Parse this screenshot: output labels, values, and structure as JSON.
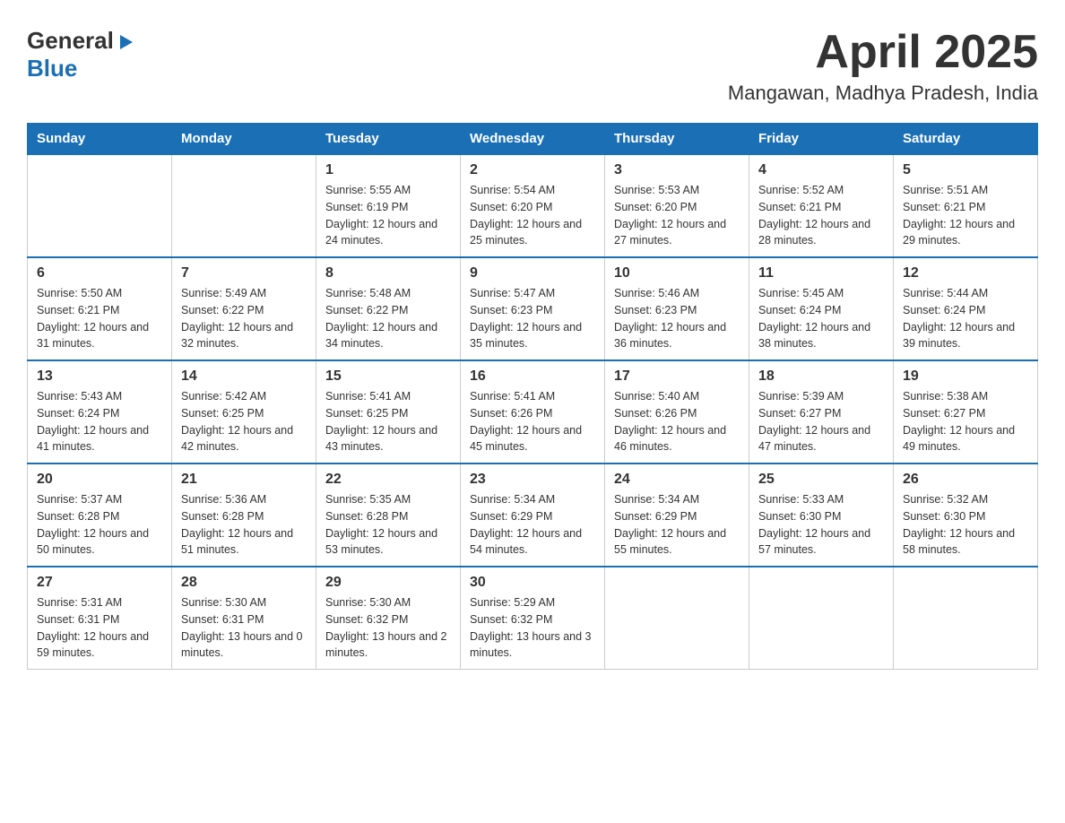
{
  "header": {
    "logo": {
      "general": "General",
      "blue": "Blue",
      "triangle": "▶"
    },
    "title": "April 2025",
    "subtitle": "Mangawan, Madhya Pradesh, India"
  },
  "calendar": {
    "headers": [
      "Sunday",
      "Monday",
      "Tuesday",
      "Wednesday",
      "Thursday",
      "Friday",
      "Saturday"
    ],
    "weeks": [
      [
        {
          "day": "",
          "sunrise": "",
          "sunset": "",
          "daylight": ""
        },
        {
          "day": "",
          "sunrise": "",
          "sunset": "",
          "daylight": ""
        },
        {
          "day": "1",
          "sunrise": "Sunrise: 5:55 AM",
          "sunset": "Sunset: 6:19 PM",
          "daylight": "Daylight: 12 hours and 24 minutes."
        },
        {
          "day": "2",
          "sunrise": "Sunrise: 5:54 AM",
          "sunset": "Sunset: 6:20 PM",
          "daylight": "Daylight: 12 hours and 25 minutes."
        },
        {
          "day": "3",
          "sunrise": "Sunrise: 5:53 AM",
          "sunset": "Sunset: 6:20 PM",
          "daylight": "Daylight: 12 hours and 27 minutes."
        },
        {
          "day": "4",
          "sunrise": "Sunrise: 5:52 AM",
          "sunset": "Sunset: 6:21 PM",
          "daylight": "Daylight: 12 hours and 28 minutes."
        },
        {
          "day": "5",
          "sunrise": "Sunrise: 5:51 AM",
          "sunset": "Sunset: 6:21 PM",
          "daylight": "Daylight: 12 hours and 29 minutes."
        }
      ],
      [
        {
          "day": "6",
          "sunrise": "Sunrise: 5:50 AM",
          "sunset": "Sunset: 6:21 PM",
          "daylight": "Daylight: 12 hours and 31 minutes."
        },
        {
          "day": "7",
          "sunrise": "Sunrise: 5:49 AM",
          "sunset": "Sunset: 6:22 PM",
          "daylight": "Daylight: 12 hours and 32 minutes."
        },
        {
          "day": "8",
          "sunrise": "Sunrise: 5:48 AM",
          "sunset": "Sunset: 6:22 PM",
          "daylight": "Daylight: 12 hours and 34 minutes."
        },
        {
          "day": "9",
          "sunrise": "Sunrise: 5:47 AM",
          "sunset": "Sunset: 6:23 PM",
          "daylight": "Daylight: 12 hours and 35 minutes."
        },
        {
          "day": "10",
          "sunrise": "Sunrise: 5:46 AM",
          "sunset": "Sunset: 6:23 PM",
          "daylight": "Daylight: 12 hours and 36 minutes."
        },
        {
          "day": "11",
          "sunrise": "Sunrise: 5:45 AM",
          "sunset": "Sunset: 6:24 PM",
          "daylight": "Daylight: 12 hours and 38 minutes."
        },
        {
          "day": "12",
          "sunrise": "Sunrise: 5:44 AM",
          "sunset": "Sunset: 6:24 PM",
          "daylight": "Daylight: 12 hours and 39 minutes."
        }
      ],
      [
        {
          "day": "13",
          "sunrise": "Sunrise: 5:43 AM",
          "sunset": "Sunset: 6:24 PM",
          "daylight": "Daylight: 12 hours and 41 minutes."
        },
        {
          "day": "14",
          "sunrise": "Sunrise: 5:42 AM",
          "sunset": "Sunset: 6:25 PM",
          "daylight": "Daylight: 12 hours and 42 minutes."
        },
        {
          "day": "15",
          "sunrise": "Sunrise: 5:41 AM",
          "sunset": "Sunset: 6:25 PM",
          "daylight": "Daylight: 12 hours and 43 minutes."
        },
        {
          "day": "16",
          "sunrise": "Sunrise: 5:41 AM",
          "sunset": "Sunset: 6:26 PM",
          "daylight": "Daylight: 12 hours and 45 minutes."
        },
        {
          "day": "17",
          "sunrise": "Sunrise: 5:40 AM",
          "sunset": "Sunset: 6:26 PM",
          "daylight": "Daylight: 12 hours and 46 minutes."
        },
        {
          "day": "18",
          "sunrise": "Sunrise: 5:39 AM",
          "sunset": "Sunset: 6:27 PM",
          "daylight": "Daylight: 12 hours and 47 minutes."
        },
        {
          "day": "19",
          "sunrise": "Sunrise: 5:38 AM",
          "sunset": "Sunset: 6:27 PM",
          "daylight": "Daylight: 12 hours and 49 minutes."
        }
      ],
      [
        {
          "day": "20",
          "sunrise": "Sunrise: 5:37 AM",
          "sunset": "Sunset: 6:28 PM",
          "daylight": "Daylight: 12 hours and 50 minutes."
        },
        {
          "day": "21",
          "sunrise": "Sunrise: 5:36 AM",
          "sunset": "Sunset: 6:28 PM",
          "daylight": "Daylight: 12 hours and 51 minutes."
        },
        {
          "day": "22",
          "sunrise": "Sunrise: 5:35 AM",
          "sunset": "Sunset: 6:28 PM",
          "daylight": "Daylight: 12 hours and 53 minutes."
        },
        {
          "day": "23",
          "sunrise": "Sunrise: 5:34 AM",
          "sunset": "Sunset: 6:29 PM",
          "daylight": "Daylight: 12 hours and 54 minutes."
        },
        {
          "day": "24",
          "sunrise": "Sunrise: 5:34 AM",
          "sunset": "Sunset: 6:29 PM",
          "daylight": "Daylight: 12 hours and 55 minutes."
        },
        {
          "day": "25",
          "sunrise": "Sunrise: 5:33 AM",
          "sunset": "Sunset: 6:30 PM",
          "daylight": "Daylight: 12 hours and 57 minutes."
        },
        {
          "day": "26",
          "sunrise": "Sunrise: 5:32 AM",
          "sunset": "Sunset: 6:30 PM",
          "daylight": "Daylight: 12 hours and 58 minutes."
        }
      ],
      [
        {
          "day": "27",
          "sunrise": "Sunrise: 5:31 AM",
          "sunset": "Sunset: 6:31 PM",
          "daylight": "Daylight: 12 hours and 59 minutes."
        },
        {
          "day": "28",
          "sunrise": "Sunrise: 5:30 AM",
          "sunset": "Sunset: 6:31 PM",
          "daylight": "Daylight: 13 hours and 0 minutes."
        },
        {
          "day": "29",
          "sunrise": "Sunrise: 5:30 AM",
          "sunset": "Sunset: 6:32 PM",
          "daylight": "Daylight: 13 hours and 2 minutes."
        },
        {
          "day": "30",
          "sunrise": "Sunrise: 5:29 AM",
          "sunset": "Sunset: 6:32 PM",
          "daylight": "Daylight: 13 hours and 3 minutes."
        },
        {
          "day": "",
          "sunrise": "",
          "sunset": "",
          "daylight": ""
        },
        {
          "day": "",
          "sunrise": "",
          "sunset": "",
          "daylight": ""
        },
        {
          "day": "",
          "sunrise": "",
          "sunset": "",
          "daylight": ""
        }
      ]
    ]
  }
}
